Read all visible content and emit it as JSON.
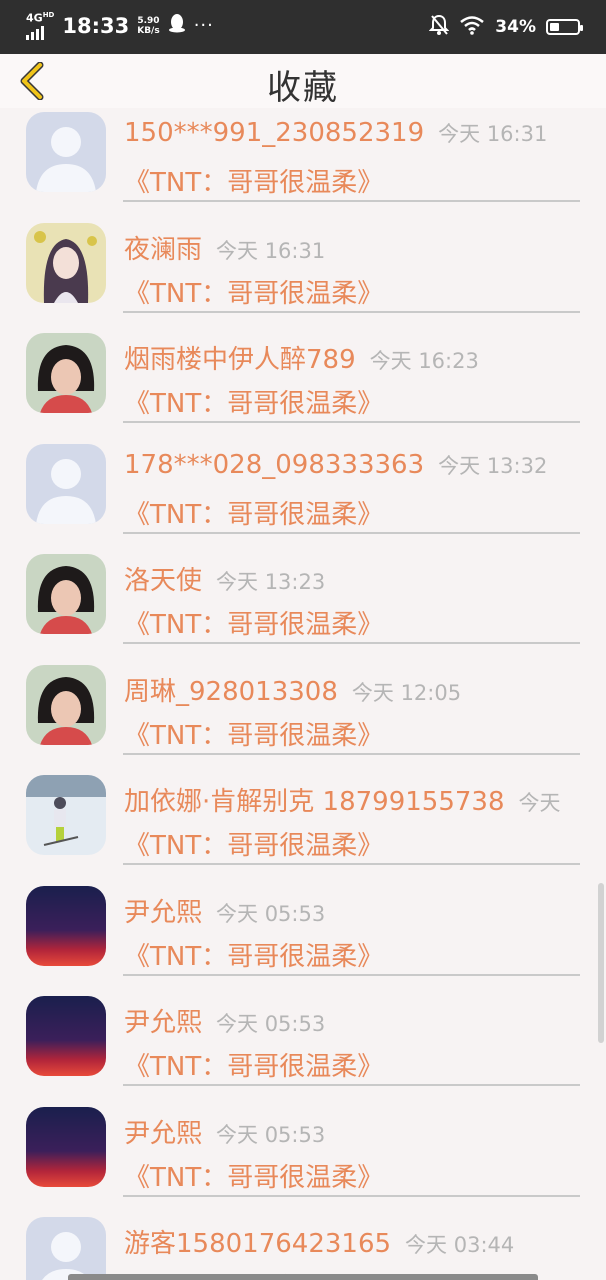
{
  "status_bar": {
    "network": "4G",
    "network_sup": "HD",
    "time": "18:33",
    "speed_value": "5.90",
    "speed_unit": "KB/s",
    "dots": "···",
    "battery_percent": "34%",
    "battery_level": 0.34
  },
  "header": {
    "title": "收藏",
    "back_icon": "chevron-left-icon",
    "accent_color": "#f0c419"
  },
  "colors": {
    "name_color": "#e8895a",
    "time_color": "#b5b5b5"
  },
  "items": [
    {
      "name": "150***991_230852319",
      "time": "今天 16:31",
      "book": "《TNT：哥哥很温柔》",
      "avatar": "default-avatar"
    },
    {
      "name": "夜澜雨",
      "time": "今天 16:31",
      "book": "《TNT：哥哥很温柔》",
      "avatar": "anime-girl-avatar"
    },
    {
      "name": "烟雨楼中伊人醉789",
      "time": "今天 16:23",
      "book": "《TNT：哥哥很温柔》",
      "avatar": "photo-avatar"
    },
    {
      "name": "178***028_098333363",
      "time": "今天 13:32",
      "book": "《TNT：哥哥很温柔》",
      "avatar": "default-avatar"
    },
    {
      "name": "洛天使",
      "time": "今天 13:23",
      "book": "《TNT：哥哥很温柔》",
      "avatar": "photo-avatar"
    },
    {
      "name": "周琳_928013308",
      "time": "今天 12:05",
      "book": "《TNT：哥哥很温柔》",
      "avatar": "photo-avatar"
    },
    {
      "name": "加依娜·肯解别克 18799155738",
      "time": "今天",
      "book": "《TNT：哥哥很温柔》",
      "avatar": "snow-photo-avatar"
    },
    {
      "name": "尹允熙",
      "time": "今天 05:53",
      "book": "《TNT：哥哥很温柔》",
      "avatar": "sunset-avatar"
    },
    {
      "name": "尹允熙",
      "time": "今天 05:53",
      "book": "《TNT：哥哥很温柔》",
      "avatar": "sunset-avatar"
    },
    {
      "name": "尹允熙",
      "time": "今天 05:53",
      "book": "《TNT：哥哥很温柔》",
      "avatar": "sunset-avatar"
    },
    {
      "name": "游客1580176423165",
      "time": "今天 03:44",
      "book": "《TNT：哥哥很温柔》",
      "avatar": "default-avatar"
    }
  ]
}
